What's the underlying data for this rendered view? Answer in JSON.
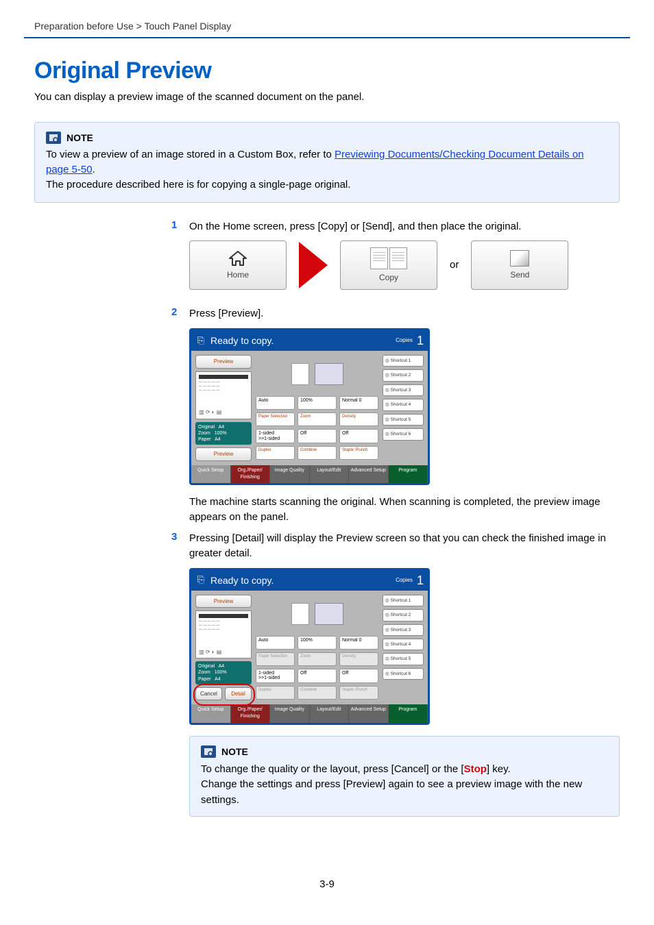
{
  "breadcrumb": "Preparation before Use > Touch Panel Display",
  "heading": "Original Preview",
  "intro": "You can display a preview image of the scanned document on the panel.",
  "note1": {
    "title": "NOTE",
    "pre": "To view a preview of an image stored in a Custom Box, refer to ",
    "link": "Previewing Documents/Checking Document Details on page 5-50",
    "post": ".",
    "line2": "The procedure described here is for copying a single-page original."
  },
  "steps": {
    "s1": {
      "num": "1",
      "text": "On the Home screen, press [Copy] or [Send], and then place the original."
    },
    "s2": {
      "num": "2",
      "text": "Press [Preview]."
    },
    "s2after": "The machine starts scanning the original. When scanning is completed, the preview image appears on the panel.",
    "s3": {
      "num": "3",
      "text": "Pressing [Detail] will display the Preview screen so that you can check the finished image in greater detail."
    }
  },
  "fig1": {
    "home": "Home",
    "copy": "Copy",
    "or": "or",
    "send": "Send"
  },
  "panel": {
    "title": "Ready to copy.",
    "copies_label": "Copies",
    "copies_value": "1",
    "preview": "Preview",
    "cancel": "Cancel",
    "detail": "Detail",
    "info": {
      "original": "Original",
      "original_v": "A4",
      "zoom": "Zoom",
      "zoom_v": "100%",
      "paper": "Paper",
      "paper_v": "A4"
    },
    "chips": {
      "auto": "Auto",
      "pct": "100%",
      "normal": "Normal 0",
      "paper_sel": "Paper Selection",
      "zoom": "Zoom",
      "density": "Density",
      "dplx1": "1-sided",
      "dplx2": ">>1-sided",
      "off": "Off",
      "duplex": "Duplex",
      "combine": "Combine",
      "staple": "Staple /Punch"
    },
    "shortcuts": [
      "Shortcut 1",
      "Shortcut 2",
      "Shortcut 3",
      "Shortcut 4",
      "Shortcut 5",
      "Shortcut 6"
    ],
    "tabs": [
      "Quick Setup",
      "Org./Paper/ Finishing",
      "Image Quality",
      "Layout/Edit",
      "Advanced Setup",
      "Program"
    ]
  },
  "note2": {
    "title": "NOTE",
    "line1_a": "To change the quality or the layout, press [Cancel] or the [",
    "stop": "Stop",
    "line1_b": "] key.",
    "line2": "Change the settings and press [Preview] again to see a preview image with the new settings."
  },
  "page_number": "3-9"
}
